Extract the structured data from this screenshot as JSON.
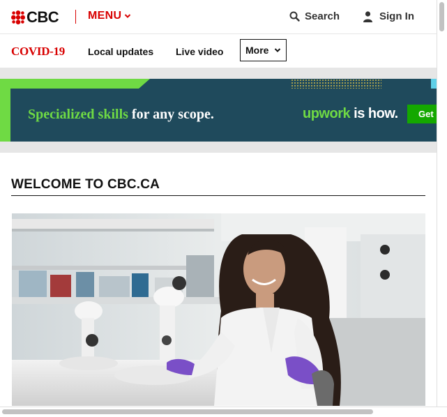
{
  "header": {
    "logo_text": "CBC",
    "menu_label": "MENU",
    "search_label": "Search",
    "signin_label": "Sign In"
  },
  "subnav": {
    "covid_label": "COVID-19",
    "links": [
      "Local updates",
      "Live video"
    ],
    "more_label": "More"
  },
  "ad": {
    "headline_highlight": "Specialized skills",
    "headline_rest": " for any scope.",
    "brand_name": "upwork",
    "brand_tagline": " is how.",
    "cta_label": "Get"
  },
  "main": {
    "section_title": "WELCOME TO CBC.CA"
  },
  "colors": {
    "cbc_red": "#d80000",
    "ad_background": "#1f4a5c",
    "upwork_green": "#6fda44",
    "cta_green": "#14a800"
  }
}
